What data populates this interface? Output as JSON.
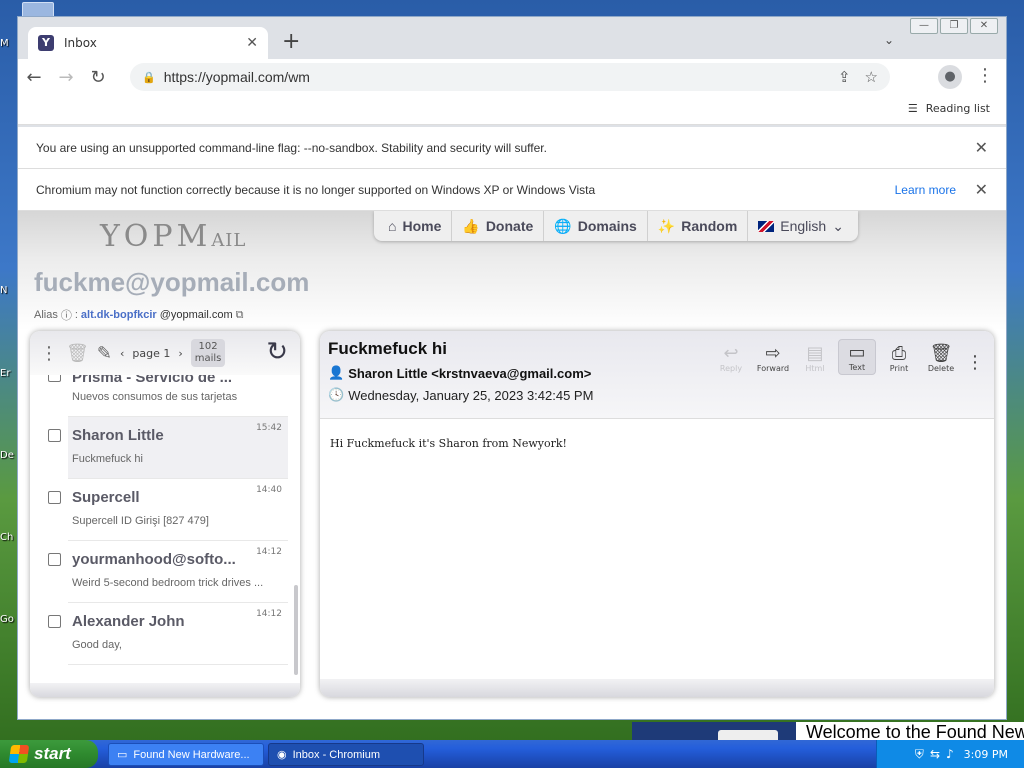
{
  "browser": {
    "tab_title": "Inbox",
    "url": "https://yopmail.com/wm",
    "reading_list": "Reading list",
    "infobar_sandbox": "You are using an unsupported command-line flag: --no-sandbox. Stability and security will suffer.",
    "infobar_xp": "Chromium may not function correctly because it is no longer supported on Windows XP or Windows Vista",
    "learn_more": "Learn more"
  },
  "site": {
    "logo": "YOPMAIL",
    "nav": [
      "Home",
      "Donate",
      "Domains",
      "Random",
      "English"
    ],
    "email": "fuckme@yopmail.com",
    "alias_label": "Alias",
    "alias_name": "alt.dk-bopfkcir",
    "alias_domain": "@yopmail.com"
  },
  "inbox": {
    "page_label": "page 1",
    "mail_count": "102",
    "mail_count_unit": "mails",
    "mails": [
      {
        "from": "Prisma - Servicio de ...",
        "subject": "Nuevos consumos de sus tarjetas",
        "time": ""
      },
      {
        "from": "Sharon Little",
        "subject": "Fuckmefuck hi",
        "time": "15:42"
      },
      {
        "from": "Supercell",
        "subject": "Supercell ID Girişi [827 479]",
        "time": "14:40"
      },
      {
        "from": "yourmanhood@softo...",
        "subject": "Weird 5-second bedroom trick drives ...",
        "time": "14:12"
      },
      {
        "from": "Alexander John",
        "subject": "Good day,",
        "time": "14:12"
      }
    ]
  },
  "mail_view": {
    "subject": "Fuckmefuck hi",
    "sender": "Sharon Little <krstnvaeva@gmail.com>",
    "date": "Wednesday, January 25, 2023 3:42:45 PM",
    "body": "Hi Fuckmefuck it's Sharon from Newyork!",
    "actions": [
      "Reply",
      "Forward",
      "Html",
      "Text",
      "Print",
      "Delete"
    ]
  },
  "taskbar": {
    "start": "start",
    "task1": "Found New Hardware...",
    "task2": "Inbox - Chromium",
    "clock": "3:09 PM"
  },
  "desktop": {
    "welcome_text": "Welcome to the Found New"
  }
}
